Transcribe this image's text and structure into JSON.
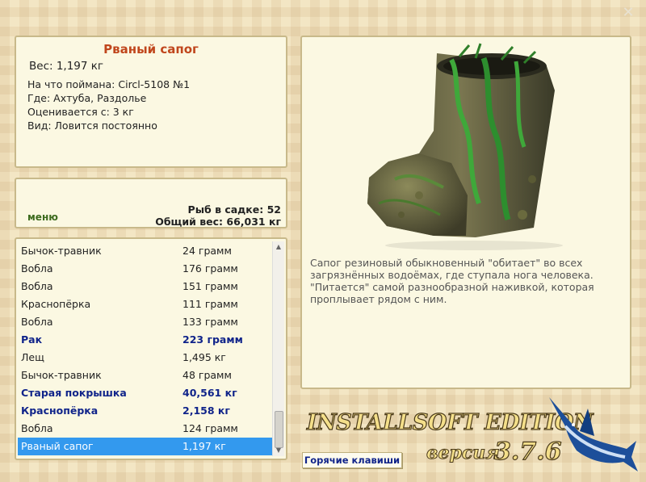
{
  "info": {
    "title": "Рваный сапог",
    "weight": "Вес: 1,197 кг",
    "caught_on": "На что поймана: Circl-5108 №1",
    "where": "Где: Ахтуба, Раздолье",
    "valued_from": "Оценивается с: 3 кг",
    "kind": "Вид: Ловится постоянно"
  },
  "menu": {
    "label": "меню",
    "keep_count": "Рыб в садке: 52",
    "total_weight": "Общий вес: 66,031 кг"
  },
  "fish_list": [
    {
      "name": "Бычок-травник",
      "weight": "24 грамм",
      "bold": false,
      "selected": false
    },
    {
      "name": "Вобла",
      "weight": "176 грамм",
      "bold": false,
      "selected": false
    },
    {
      "name": "Вобла",
      "weight": "151 грамм",
      "bold": false,
      "selected": false
    },
    {
      "name": "Краснопёрка",
      "weight": "111 грамм",
      "bold": false,
      "selected": false
    },
    {
      "name": "Вобла",
      "weight": "133 грамм",
      "bold": false,
      "selected": false
    },
    {
      "name": "Рак",
      "weight": "223 грамм",
      "bold": true,
      "selected": false
    },
    {
      "name": "Лещ",
      "weight": "1,495 кг",
      "bold": false,
      "selected": false
    },
    {
      "name": "Бычок-травник",
      "weight": "48 грамм",
      "bold": false,
      "selected": false
    },
    {
      "name": "Старая покрышка",
      "weight": "40,561 кг",
      "bold": true,
      "selected": false
    },
    {
      "name": "Краснопёрка",
      "weight": "2,158 кг",
      "bold": true,
      "selected": false
    },
    {
      "name": "Вобла",
      "weight": "124 грамм",
      "bold": false,
      "selected": false
    },
    {
      "name": "Рваный сапог",
      "weight": "1,197 кг",
      "bold": false,
      "selected": true
    }
  ],
  "description": "Сапог резиновый обыкновенный \"обитает\" во всех загрязнённых водоёмах, где ступала нога человека. \"Питается\" самой разнообразной наживкой, которая проплывает рядом с ним.",
  "hotkeys_label": "Горячие клавиши",
  "branding": {
    "edition": "INSTALLSOFT EDITION",
    "version_label": "версия",
    "version_number": "3.7.6"
  },
  "icons": {
    "close": "close-icon",
    "boot": "boot-image",
    "marlin": "marlin-icon"
  },
  "colors": {
    "title": "#c0461c",
    "bold_item": "#10248a",
    "selected_row": "#3399ee",
    "menu": "#3d6b1e"
  }
}
